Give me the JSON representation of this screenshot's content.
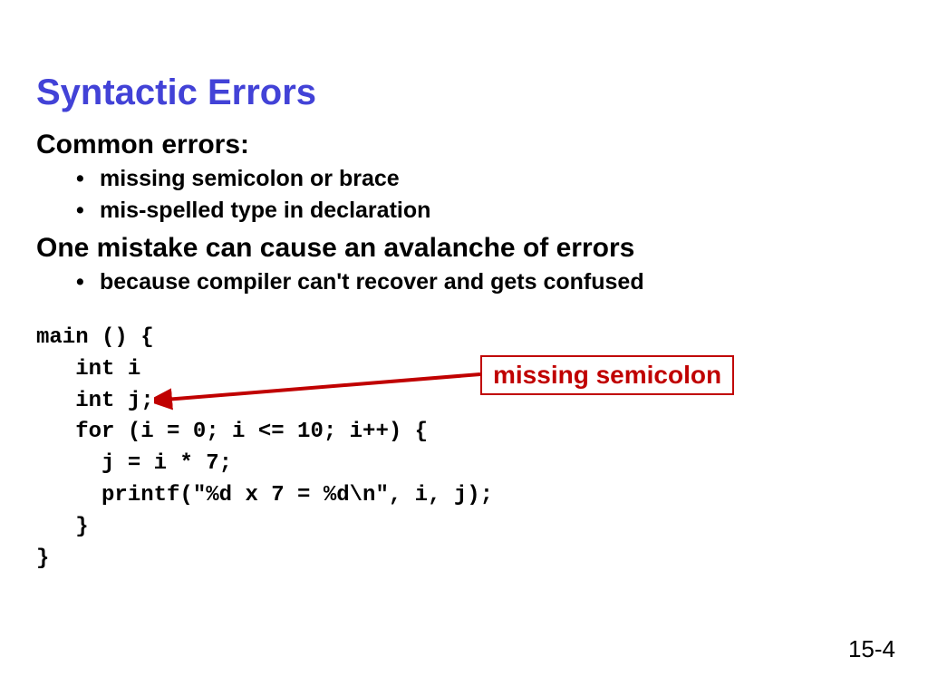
{
  "title": "Syntactic Errors",
  "sections": {
    "common": {
      "heading": "Common errors:",
      "bullets": [
        "missing semicolon or brace",
        "mis-spelled type in declaration"
      ]
    },
    "avalanche": {
      "heading": "One mistake can cause an avalanche of errors",
      "bullets": [
        "because compiler can't recover and gets confused"
      ]
    }
  },
  "code": "main () {\n   int i\n   int j;\n   for (i = 0; i <= 10; i++) {\n     j = i * 7;\n     printf(\"%d x 7 = %d\\n\", i, j);\n   }\n}",
  "callout": "missing semicolon",
  "page_number": "15-4",
  "colors": {
    "title": "#4242d7",
    "callout": "#c00000"
  }
}
